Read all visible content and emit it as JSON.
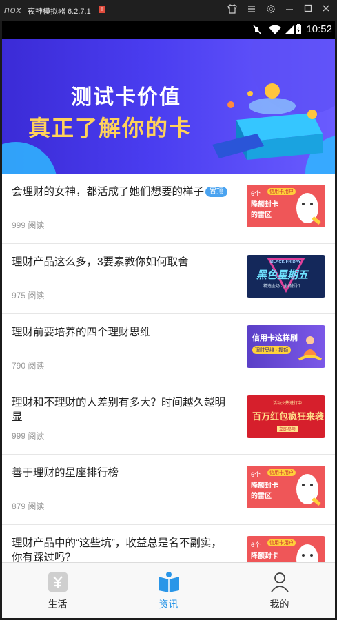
{
  "emulator": {
    "logo": "nox",
    "title": "夜神模拟器 6.2.7.1",
    "controls": [
      "shirt-icon",
      "menu-icon",
      "gear-icon",
      "minimize-icon",
      "maximize-icon",
      "close-icon"
    ]
  },
  "status_bar": {
    "time": "10:52",
    "icons": [
      "mute-icon",
      "wifi-icon",
      "signal-icon",
      "battery-icon"
    ]
  },
  "banner": {
    "line1": "测试卡价值",
    "line2": "真正了解你的卡"
  },
  "news": [
    {
      "title": "会理财的女神，都活成了她们想要的样子",
      "badge": "置顶",
      "reads": "999 阅读",
      "thumb": {
        "style": "red",
        "lines": [
          "6个",
          "降额封卡",
          "的雷区"
        ],
        "tag": "信用卡用户"
      }
    },
    {
      "title": "理财产品这么多，3要素教你如何取舍",
      "reads": "975 阅读",
      "thumb": {
        "style": "navy",
        "lines": [
          "BLACK FRIDAY",
          "黑色星期五",
          "精选全场 · 全场折扣"
        ]
      }
    },
    {
      "title": "理财前要培养的四个理财思维",
      "reads": "790 阅读",
      "thumb": {
        "style": "purple",
        "lines": [
          "信用卡这样刷",
          "理财思维 · 提额"
        ]
      }
    },
    {
      "title": "理财和不理财的人差别有多大？时间越久越明显",
      "reads": "999 阅读",
      "thumb": {
        "style": "crimson",
        "lines": [
          "活动火热进行中",
          "百万红包疯狂来袭",
          "立即参与"
        ]
      }
    },
    {
      "title": "善于理财的星座排行榜",
      "reads": "879 阅读",
      "thumb": {
        "style": "red",
        "lines": [
          "6个",
          "降额封卡",
          "的雷区"
        ],
        "tag": "信用卡用户"
      }
    },
    {
      "title": "理财产品中的“这些坑”，收益总是名不副实，你有踩过吗？",
      "reads": "",
      "thumb": {
        "style": "red",
        "lines": [
          "6个",
          "降额封卡"
        ],
        "tag": "信用卡用户"
      }
    }
  ],
  "tabs": [
    {
      "label": "生活",
      "icon": "life-yen-icon",
      "active": false
    },
    {
      "label": "资讯",
      "icon": "news-book-icon",
      "active": true
    },
    {
      "label": "我的",
      "icon": "profile-person-icon",
      "active": false
    }
  ],
  "colors": {
    "accent": "#2a96e8",
    "banner_start": "#3b2bd6",
    "banner_end": "#6a5cff",
    "thumb_red": "#ef5658"
  }
}
